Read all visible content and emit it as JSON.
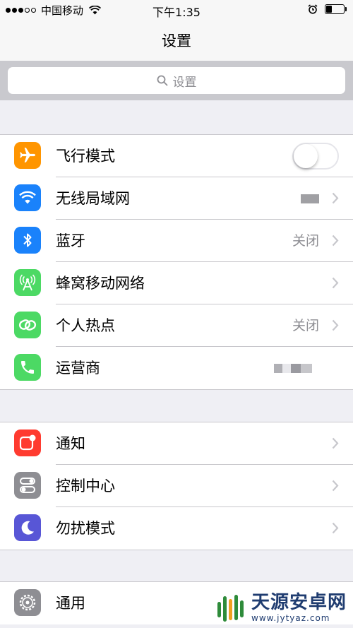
{
  "status_bar": {
    "carrier": "中国移动",
    "time": "下午1:35",
    "battery_level": 0.35
  },
  "nav": {
    "title": "设置"
  },
  "search": {
    "placeholder": "设置"
  },
  "colors": {
    "airplane": "#ff9500",
    "wifi": "#1a82fb",
    "bluetooth": "#1a82fb",
    "cellular": "#4cd964",
    "hotspot": "#4cd964",
    "carrier": "#4cd964",
    "notifications": "#ff3b30",
    "control_center": "#8e8e93",
    "do_not_disturb": "#5856d6",
    "general": "#8e8e93"
  },
  "group1": {
    "airplane": {
      "label": "飞行模式",
      "icon": "airplane-icon",
      "toggle_on": false
    },
    "wifi": {
      "label": "无线局域网",
      "icon": "wifi-icon"
    },
    "bluetooth": {
      "label": "蓝牙",
      "icon": "bluetooth-icon",
      "value": "关闭"
    },
    "cellular": {
      "label": "蜂窝移动网络",
      "icon": "cellular-antenna-icon"
    },
    "hotspot": {
      "label": "个人热点",
      "icon": "hotspot-link-icon",
      "value": "关闭"
    },
    "carrier": {
      "label": "运营商",
      "icon": "phone-icon"
    }
  },
  "group2": {
    "notifications": {
      "label": "通知",
      "icon": "notification-icon"
    },
    "control_center": {
      "label": "控制中心",
      "icon": "control-center-icon"
    },
    "do_not_disturb": {
      "label": "勿扰模式",
      "icon": "moon-icon"
    }
  },
  "group3": {
    "general": {
      "label": "通用",
      "icon": "gear-icon"
    }
  },
  "watermark": {
    "title": "天源安卓网",
    "url": "www.jytyaz.com"
  }
}
